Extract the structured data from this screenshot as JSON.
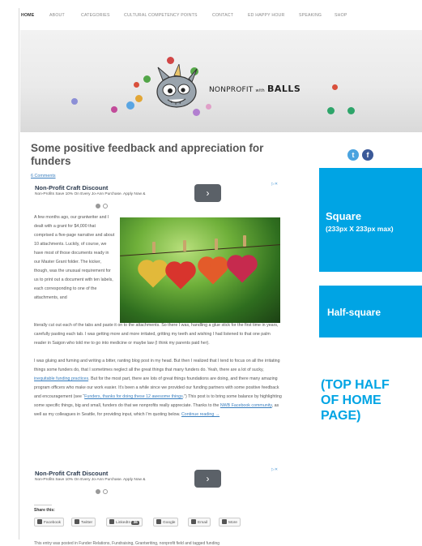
{
  "nav": {
    "items": [
      {
        "label": "HOME",
        "active": true
      },
      {
        "label": "ABOUT",
        "active": false
      },
      {
        "label": "CATEGORIES",
        "active": false
      },
      {
        "label": "CULTURAL COMPETENCY POINTS",
        "active": false
      },
      {
        "label": "CONTACT",
        "active": false
      },
      {
        "label": "ED HAPPY HOUR",
        "active": false
      },
      {
        "label": "SPEAKING",
        "active": false
      },
      {
        "label": "SHOP",
        "active": false
      }
    ]
  },
  "header": {
    "logo_prefix": "NONPROFIT",
    "logo_with": "with",
    "logo_balls": "BALLS"
  },
  "post": {
    "title": "Some positive feedback and appreciation for funders",
    "comments_link": "6 Comments",
    "narrow_paragraph": "A few months ago, our grantwriter and I dealt with a grant for $4,000 that comprised a five-page narrative and about 10 attachments. Luckily, of course, we have most of those documents ready in our Master Grant folder. The kicker, though, was the unusual requirement for us to print out a document with ten labels, each corresponding to one of the attachments, and",
    "wide_paragraph": "literally cut out each of the tabs and paste it on to the attachments. So there I was, handling a glue stick for the first time in years, carefully pasting each tab. I was getting more and more irritated, gritting my teeth and wishing I had listened to that one palm reader in Saigon who told me to go into medicine or maybe law (I think my parents paid her).",
    "p2_a": "I was gluing and fuming and writing a bitter, ranting blog post in my head. But then I realized that I tend to focus on all the irritating things some funders do, that I sometimes neglect all the great things that many funders do. Yeah, there are a lot of sucky, ",
    "p2_link1": "inequitable funding practices",
    "p2_b": ". But for the most part, there are lots of great things foundations are doing, and there many amazing program officers who make our work easier. It’s been a while since we provided our funding partners with some positive feedback and encouragement (see “",
    "p2_link2": "Funders, thanks for doing these 12 awesome things",
    "p2_c": ".”) This post is to bring some balance by highlighting some specific things, big and small, funders do that we nonprofits really appreciate. Thanks to the ",
    "p2_link3": "NWB Facebook community",
    "p2_d": ", as well as my colleagues in Seattle, for providing input, which I’m quoting below. ",
    "p2_link4": "Continue reading →"
  },
  "ads": [
    {
      "title": "Non-Profit Craft Discount",
      "subtitle": "Non-Profits Save 10% On Every Jo-Ann Purchase. Apply Now &",
      "arrow": "›",
      "badge": "▷✕"
    },
    {
      "title": "Non-Profit Craft Discount",
      "subtitle": "Non-Profits Save 10% On Every Jo-Ann Purchase. Apply Now &",
      "arrow": "›",
      "badge": "▷✕"
    }
  ],
  "share": {
    "label": "Share this:",
    "buttons": [
      {
        "label": "Facebook"
      },
      {
        "label": "Twitter"
      },
      {
        "label": "LinkedIn",
        "count": "36"
      },
      {
        "label": "Google"
      },
      {
        "label": "Email"
      },
      {
        "label": "More"
      }
    ]
  },
  "footer_text": "This entry was posted in Funder Relations, Fundraising, Grantwriting, nonprofit field and tagged funding",
  "sidebar": {
    "square_title": "Square",
    "square_sub": "(233px X 233px max)",
    "half_title": "Half-square",
    "top_half": "(TOP HALF OF HOME PAGE)"
  },
  "colors": {
    "accent": "#00a4e4",
    "link": "#3a7fbf",
    "twitter": "#4aa3df",
    "facebook": "#3b5998"
  }
}
